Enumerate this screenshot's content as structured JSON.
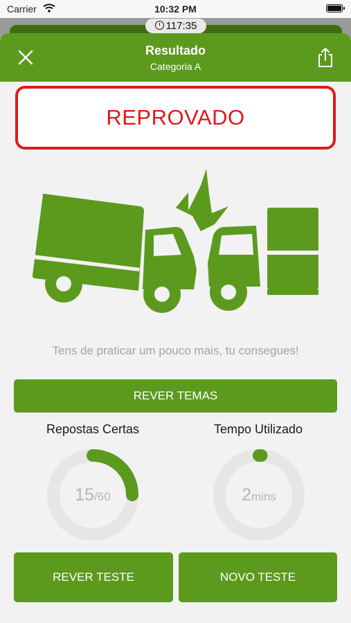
{
  "status_bar": {
    "carrier": "Carrier",
    "time": "10:32 PM"
  },
  "timer": {
    "value": "117:35"
  },
  "nav": {
    "title": "Resultado",
    "subtitle": "Categoria A"
  },
  "result": {
    "label": "REPROVADO",
    "color": "#e01818"
  },
  "illustration": {
    "icon": "truck-crash-icon"
  },
  "message": "Tens de praticar um pouco mais, tu consegues!",
  "buttons": {
    "review_topics": "REVER TEMAS",
    "review_test": "REVER TESTE",
    "new_test": "NOVO TESTE"
  },
  "stats": {
    "correct": {
      "label": "Repostas Certas",
      "value": "15",
      "total": "/60",
      "progress": 0.25
    },
    "time": {
      "label": "Tempo Utilizado",
      "value": "2",
      "unit": "mins",
      "progress": 0.01
    }
  },
  "colors": {
    "accent": "#5c9a1e",
    "track": "#e6e6e6"
  }
}
